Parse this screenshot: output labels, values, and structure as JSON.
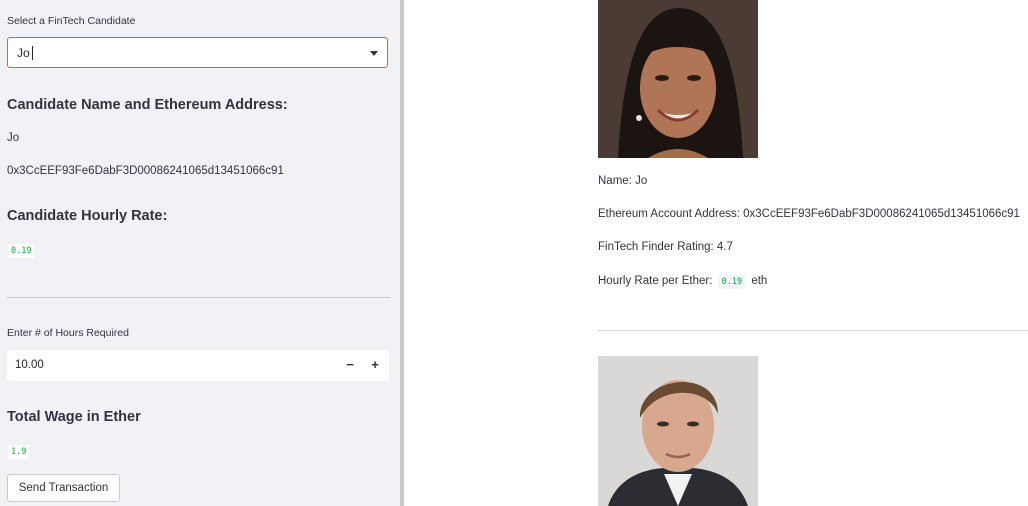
{
  "sidebar": {
    "select_label": "Select a FinTech Candidate",
    "select_value": "Jo",
    "name_address_heading": "Candidate Name and Ethereum Address:",
    "candidate_name": "Jo",
    "candidate_address": "0x3CcEEF93Fe6DabF3D00086241065d13451066c91",
    "hourly_rate_heading": "Candidate Hourly Rate:",
    "hourly_rate_value": "0.19",
    "hours_label": "Enter # of Hours Required",
    "hours_value": "10.00",
    "decrement_label": "−",
    "increment_label": "+",
    "total_wage_heading": "Total Wage in Ether",
    "total_wage_value": "1.9",
    "send_button_label": "Send Transaction"
  },
  "main": {
    "candidates": [
      {
        "name_line": "Name: Jo",
        "address_line": "Ethereum Account Address: 0x3CcEEF93Fe6DabF3D00086241065d13451066c91",
        "rating_line": "FinTech Finder Rating: 4.7",
        "rate_prefix": "Hourly Rate per Ether:",
        "rate_value": "0.19",
        "rate_suffix": "eth"
      }
    ]
  },
  "colors": {
    "accent_border": "#ff4b4b",
    "code_text": "#09ab3b",
    "sidebar_bg": "#f0f2f6"
  }
}
